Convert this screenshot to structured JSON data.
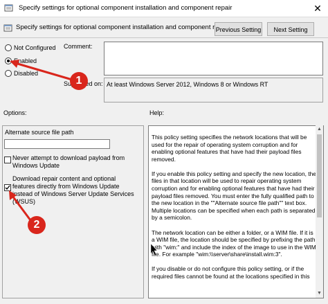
{
  "window": {
    "title": "Specify settings for optional component installation and component repair",
    "close_glyph": "✕"
  },
  "header": {
    "subtitle": "Specify settings for optional component installation and component repair",
    "previous_button": "Previous Setting",
    "next_button": "Next Setting"
  },
  "state": {
    "options": [
      {
        "label": "Not Configured",
        "selected": false
      },
      {
        "label": "Enabled",
        "selected": true
      },
      {
        "label": "Disabled",
        "selected": false
      }
    ],
    "comment_label": "Comment:",
    "supported_label": "Supported on:",
    "supported_value": "At least Windows Server 2012, Windows 8 or Windows RT"
  },
  "options_panel": {
    "label": "Options:",
    "path_label": "Alternate source file path",
    "path_value": "",
    "check1_label": "Never attempt to download payload from Windows Update",
    "check1_checked": false,
    "check2_label": "Download repair content and optional features directly from Windows Update instead of Windows Server Update Services (WSUS)",
    "check2_checked": true
  },
  "help_panel": {
    "label": "Help:",
    "paragraphs": [
      "This policy setting specifies the network locations that will be used for the repair of operating system corruption and for enabling optional features that have had their payload files removed.",
      "If you enable this policy setting and specify the new location, the files in that location will be used to repair operating system corruption and for enabling optional features that have had their payload files removed. You must enter the fully qualified path to the new location in the \"\"Alternate source file path\"\" text box. Multiple locations can be specified when each path is separated by a semicolon.",
      "The network location can be either a folder, or a WIM file. If it is a WIM file, the location should be specified by prefixing the path with \"wim:\" and include the index of the image to use in the WIM file. For example \"wim:\\\\server\\share\\install.wim:3\".",
      "If you disable or do not configure this policy setting, or if the required files cannot be found at the locations specified in this"
    ]
  },
  "annotations": {
    "marker1": "1",
    "marker2": "2",
    "color": "#d9261c"
  },
  "icons": {
    "app": "group-policy-icon",
    "close": "close-icon",
    "header": "group-policy-icon"
  }
}
